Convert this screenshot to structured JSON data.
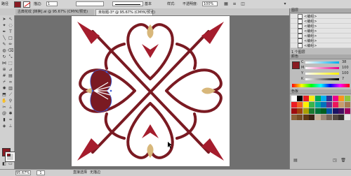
{
  "control_bar": {
    "fill_color": "#8a1a22",
    "stroke_value": "1",
    "stroke_label": "描边:",
    "style_label": "基本",
    "opacity_label": "不透明度:",
    "opacity_value": "100%",
    "style2_label": "样式:"
  },
  "tabs": [
    {
      "label": "古典花纹 [转换].ai @ 95.67% (CMYK/预览)",
      "active": false
    },
    {
      "label": "未标题-3* @ 95.67% (CMYK/预览)",
      "active": true
    }
  ],
  "status_bar": {
    "zoom": "95.67%",
    "page": "1",
    "mode": "直接选择",
    "info": "无描边"
  },
  "layers_panel": {
    "title": "图层",
    "items": [
      "<编组>",
      "<编组>",
      "<编组>",
      "<编组>",
      "<编组>",
      "<编组>",
      "<编组>"
    ],
    "footer": "1 个图层"
  },
  "color_panel": {
    "title": "颜色",
    "c_label": "C",
    "c_value": "38",
    "m_label": "M",
    "m_value": "100",
    "y_label": "Y",
    "y_value": "100",
    "k_label": "K",
    "k_value": "7",
    "fill_color": "#8a1a22"
  },
  "swatches_panel": {
    "title": "色板",
    "colors": [
      "#ffffff",
      "#000000",
      "#e31e24",
      "#f6eb14",
      "#00a651",
      "#00aeef",
      "#2e3192",
      "#ec008c",
      "#f7941d",
      "#8dc63f",
      "#ed1c24",
      "#f26522",
      "#fff200",
      "#39b54a",
      "#00a99d",
      "#0072bc",
      "#662d91",
      "#ed145b",
      "#c69c6d",
      "#a67c52",
      "#9e0b0f",
      "#a0410d",
      "#aba000",
      "#197b30",
      "#007236",
      "#005e20",
      "#0054a6",
      "#1b1464",
      "#440e62",
      "#9e005d",
      "#8c6239",
      "#754c24",
      "#603913",
      "#3c2415",
      "#c7b299",
      "#998675",
      "#736357",
      "#534741",
      "#362f2d",
      "#e6e6e6"
    ]
  },
  "art_colors": {
    "dark_red": "#7a1a22",
    "red": "#a51d2d",
    "tan": "#d8b77a",
    "blue": "#3b5bd6"
  }
}
